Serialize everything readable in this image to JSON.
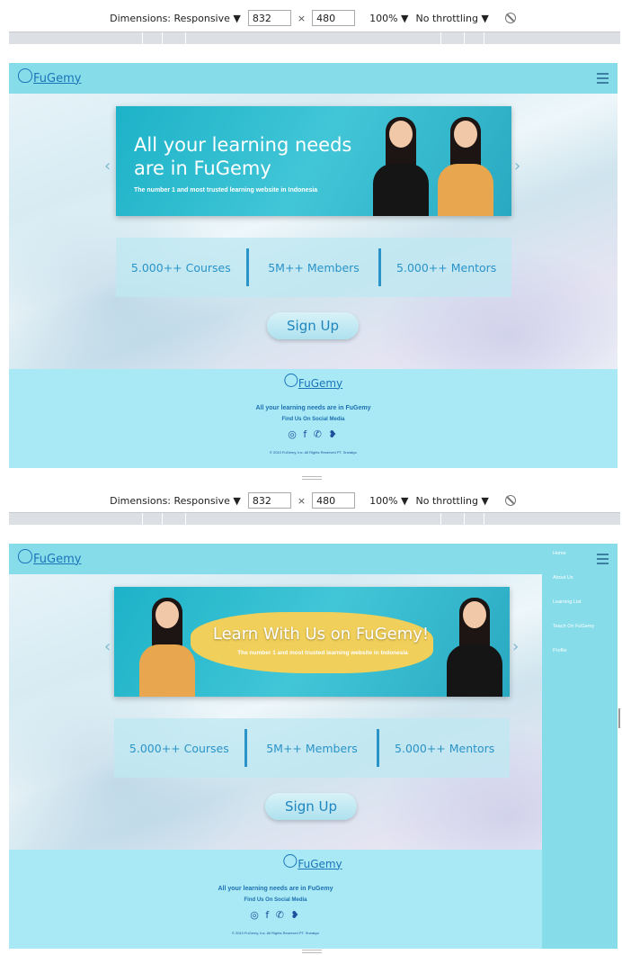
{
  "devtools": {
    "dimensions_label": "Dimensions: Responsive ▼",
    "width": "832",
    "times": "×",
    "height": "480",
    "zoom": "100% ▼",
    "throttling": "No throttling ▼"
  },
  "site": {
    "logo_text": "FuGemy",
    "slide1": {
      "headline": "All your learning needs are in FuGemy",
      "subline": "The number 1 and most trusted learning website in Indonesia"
    },
    "slide2": {
      "headline": "Learn With Us on FuGemy!",
      "subline": "The number 1 and most trusted learning website in Indonesia"
    },
    "prev_arrow": "‹",
    "next_arrow": "›",
    "stats": [
      "5.000++ Courses",
      "5M++ Members",
      "5.000++ Mentors"
    ],
    "signup_label": "Sign Up",
    "footer": {
      "logo_text": "FuGemy",
      "tagline": "All your learning needs are in FuGemy",
      "social_heading": "Find Us On Social Media",
      "social_icons": "◎ f ✆ ❥",
      "copyright": "© 2010 FuGemy, Inc. All Rights Reserved PT. Sneakyz"
    },
    "menu": [
      "Home",
      "About Us",
      "Learning List",
      "Teach On FuGemy",
      "Profile"
    ]
  }
}
